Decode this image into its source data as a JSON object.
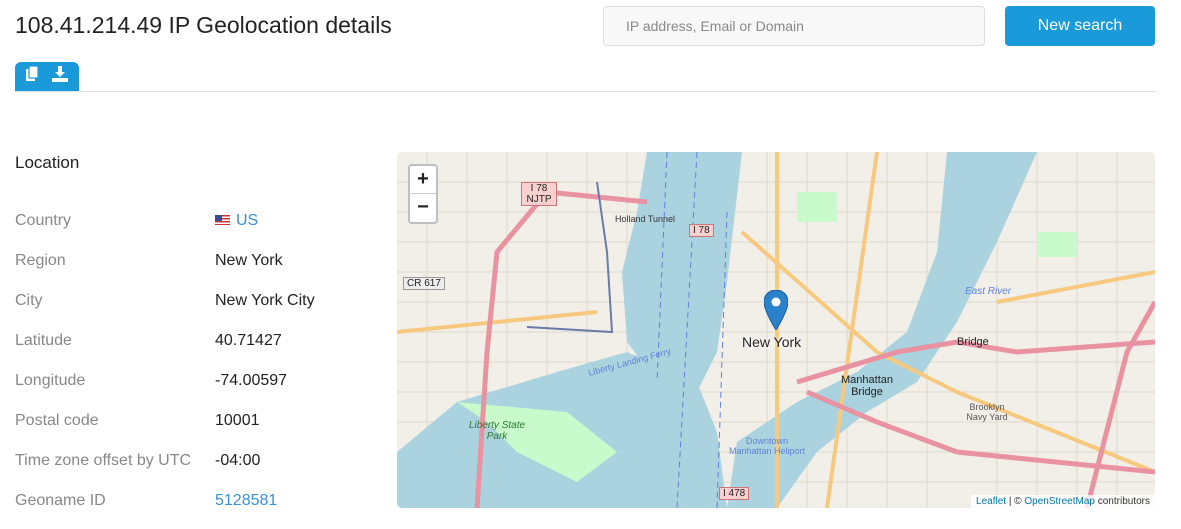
{
  "header": {
    "title": "108.41.214.49 IP Geolocation details",
    "search_placeholder": "IP address, Email or Domain",
    "search_button": "New search"
  },
  "toolbar": {
    "icons": [
      "copy-icon",
      "download-icon"
    ]
  },
  "location": {
    "heading": "Location",
    "rows": [
      {
        "key": "Country",
        "value": "US"
      },
      {
        "key": "Region",
        "value": "New York"
      },
      {
        "key": "City",
        "value": "New York City"
      },
      {
        "key": "Latitude",
        "value": "40.71427"
      },
      {
        "key": "Longitude",
        "value": "-74.00597"
      },
      {
        "key": "Postal code",
        "value": "10001"
      },
      {
        "key": "Time zone offset by UTC",
        "value": "-04:00"
      },
      {
        "key": "Geoname ID",
        "value": "5128581"
      }
    ]
  },
  "map": {
    "zoom_in": "+",
    "zoom_out": "−",
    "attribution": {
      "leaflet": "Leaflet",
      "sep": " | © ",
      "osm": "OpenStreetMap",
      "suffix": " contributors"
    },
    "labels": {
      "city": "New York",
      "manhattan_bridge": "Manhattan Bridge",
      "bridge": "Bridge",
      "liberty": "Liberty State Park",
      "heliport": "Downtown Manhattan Heliport",
      "navy_yard": "Brooklyn Navy Yard",
      "east_river": "East River",
      "holland": "Holland Tunnel",
      "i78njtp": "I 78 NJTP",
      "i78": "I 78",
      "cr617": "CR 617",
      "i478": "I 478",
      "ferry": "Liberty Landing Ferry"
    }
  }
}
